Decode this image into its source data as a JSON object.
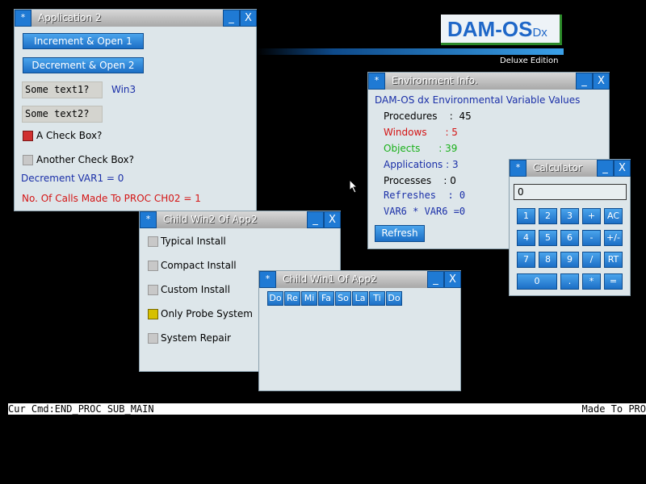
{
  "logo": {
    "main": "DAM-OS",
    "sub": "Dx",
    "tagline": "Deluxe Edition"
  },
  "app2": {
    "menu": "*",
    "title": "Application 2",
    "min": "_",
    "close": "X",
    "btn_increment": "Increment & Open 1",
    "btn_decrement": "Decrement & Open 2",
    "text1": "Some text1?",
    "text1_tag": "Win3",
    "text2": "Some text2?",
    "checkbox1": "A Check Box?",
    "checkbox2": "Another Check Box?",
    "var_label": "Decrement VAR1 = 0",
    "calls_label": "No. Of Calls Made To PROC CH02 = 1"
  },
  "env": {
    "menu": "*",
    "title": "Environment Info.",
    "min": "_",
    "close": "X",
    "header": "DAM-OS dx Environmental Variable Values",
    "procedures": "Procedures    :  45",
    "windows": "Windows      : 5",
    "objects": "Objects      : 39",
    "applications": "Applications : 3",
    "processes": "Processes    : 0",
    "refreshes": "Refreshes  : 0",
    "var6": "VAR6 * VAR6 =0",
    "refresh_btn": "Refresh"
  },
  "calc": {
    "menu": "*",
    "title": "Calculator",
    "min": "_",
    "close": "X",
    "display": "0",
    "keys": {
      "k1": "1",
      "k2": "2",
      "k3": "3",
      "plus": "+",
      "ac": "AC",
      "k4": "4",
      "k5": "5",
      "k6": "6",
      "minus": "-",
      "plusminus": "+/-",
      "k7": "7",
      "k8": "8",
      "k9": "9",
      "div": "/",
      "rt": "RT",
      "k0": "0",
      "dot": ".",
      "mul": "*",
      "eq": "="
    }
  },
  "child2": {
    "menu": "*",
    "title": "Child Win2 Of App2",
    "min": "_",
    "close": "X",
    "opt1": "Typical Install",
    "opt2": "Compact Install",
    "opt3": "Custom Install",
    "opt4": "Only Probe System",
    "opt5": "System Repair"
  },
  "child1": {
    "menu": "*",
    "title": "Child Win1 Of App2",
    "min": "_",
    "close": "X",
    "notes": [
      "Do",
      "Re",
      "Mi",
      "Fa",
      "So",
      "La",
      "Ti",
      "Do"
    ]
  },
  "status": {
    "left": "Cur Cmd:END_PROC SUB_MAIN",
    "right": "Made To PRO"
  },
  "colors": {
    "accent": "#1f7ad4",
    "window_bg": "#dde6ea",
    "desktop": "#000000"
  }
}
